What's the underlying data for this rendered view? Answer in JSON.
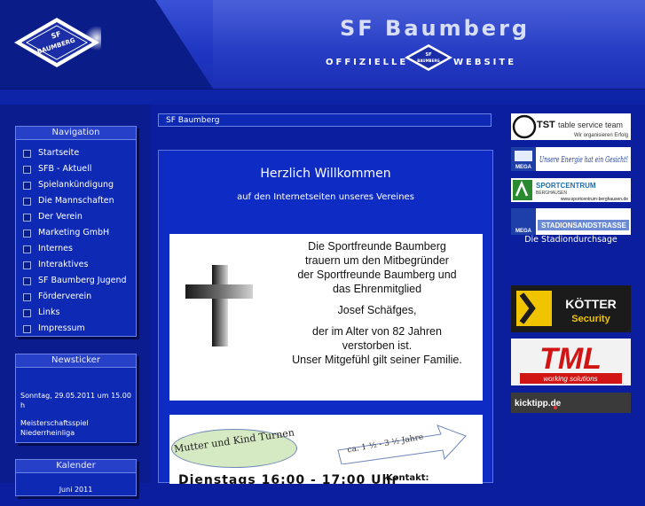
{
  "header": {
    "site_title": "SF Baumberg",
    "tagline_left": "OFFIZIELLE",
    "tagline_right": "WEBSITE",
    "logo_text_top": "SF",
    "logo_text_bottom": "BAUMBERG"
  },
  "navigation": {
    "title": "Navigation",
    "items": [
      {
        "label": "Startseite"
      },
      {
        "label": "SFB - Aktuell"
      },
      {
        "label": "Spielankündigung"
      },
      {
        "label": "Die Mannschaften"
      },
      {
        "label": "Der Verein"
      },
      {
        "label": "Marketing GmbH"
      },
      {
        "label": "Internes"
      },
      {
        "label": "Interaktives"
      },
      {
        "label": "SF Baumberg Jugend"
      },
      {
        "label": "Förderverein"
      },
      {
        "label": "Links"
      },
      {
        "label": "Impressum"
      }
    ]
  },
  "newsticker": {
    "title": "Newsticker",
    "date": "Sonntag, 29.05.2011 um 15.00 h",
    "text": "Meisterschaftsspiel Niederrheinliga"
  },
  "calendar": {
    "title": "Kalender",
    "month": "Juni 2011"
  },
  "breadcrumb": "SF Baumberg",
  "main": {
    "welcome_title": "Herzlich Willkommen",
    "welcome_sub": "auf den Internetseiten unseres Vereines",
    "memorial_lines": [
      "Die Sportfreunde Baumberg",
      "trauern um den Mitbegründer",
      "der Sportfreunde Baumberg und",
      "das Ehrenmitglied",
      "",
      "Josef Schäfges,",
      "",
      "der im Alter von 82 Jahren",
      "verstorben ist.",
      "Unser Mitgefühl gilt seiner Familie."
    ],
    "turnen_title": "Mutter und Kind Turnen",
    "turnen_age": "ca. 1 ½ - 3 ½ Jahre",
    "turnen_day": "Dienstags 16:00 - 17:00 Uhr",
    "turnen_contact": "Kontakt:"
  },
  "sponsors": {
    "tst_name": "TST",
    "tst_line1": "table service team",
    "tst_line2": "Wir organisieren Erfolg",
    "mega_brand": "MEGA",
    "mega_slogan": "Unsere Energie hat ein Gesicht!",
    "sport_name": "SPORTCENTRUM",
    "sport_place": "BERGHAUSEN",
    "sport_url": "www.sportcentrum-berghausen.de",
    "stadion_brand": "MEGA",
    "stadion_name": "STADIONSANDSTRASSE",
    "stadion_caption": "Die Stadiondurchsage",
    "koetter_name": "KÖTTER",
    "koetter_sub": "Security",
    "tml_name": "TML",
    "tml_sub": "working solutions",
    "kicktipp": "kicktipp.de"
  },
  "colors": {
    "background": "#0b1f9e",
    "panel": "#0e2ab5",
    "border": "#6b84e6"
  }
}
